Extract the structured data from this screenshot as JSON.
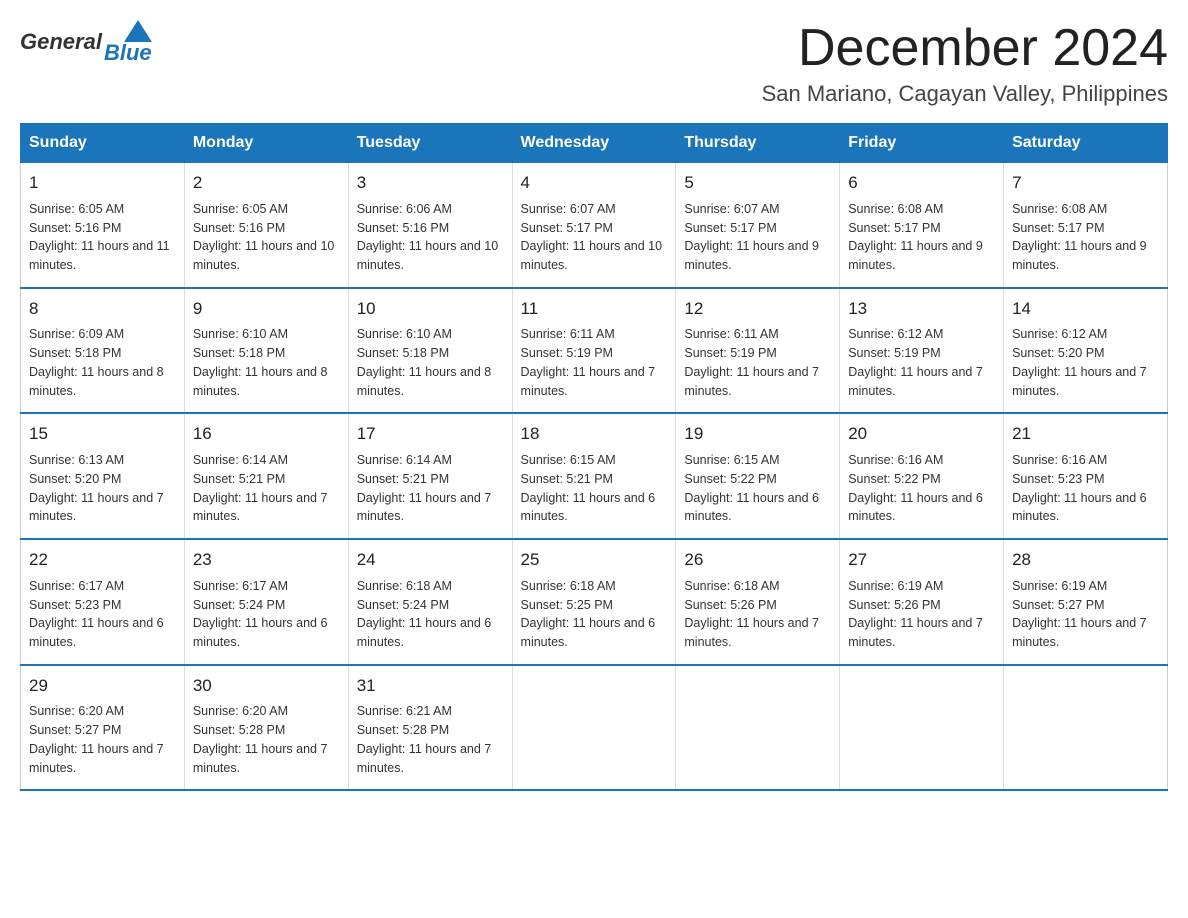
{
  "logo": {
    "general": "General",
    "blue": "Blue"
  },
  "header": {
    "month": "December 2024",
    "location": "San Mariano, Cagayan Valley, Philippines"
  },
  "days_of_week": [
    "Sunday",
    "Monday",
    "Tuesday",
    "Wednesday",
    "Thursday",
    "Friday",
    "Saturday"
  ],
  "weeks": [
    [
      {
        "day": "1",
        "sunrise": "6:05 AM",
        "sunset": "5:16 PM",
        "daylight": "11 hours and 11 minutes."
      },
      {
        "day": "2",
        "sunrise": "6:05 AM",
        "sunset": "5:16 PM",
        "daylight": "11 hours and 10 minutes."
      },
      {
        "day": "3",
        "sunrise": "6:06 AM",
        "sunset": "5:16 PM",
        "daylight": "11 hours and 10 minutes."
      },
      {
        "day": "4",
        "sunrise": "6:07 AM",
        "sunset": "5:17 PM",
        "daylight": "11 hours and 10 minutes."
      },
      {
        "day": "5",
        "sunrise": "6:07 AM",
        "sunset": "5:17 PM",
        "daylight": "11 hours and 9 minutes."
      },
      {
        "day": "6",
        "sunrise": "6:08 AM",
        "sunset": "5:17 PM",
        "daylight": "11 hours and 9 minutes."
      },
      {
        "day": "7",
        "sunrise": "6:08 AM",
        "sunset": "5:17 PM",
        "daylight": "11 hours and 9 minutes."
      }
    ],
    [
      {
        "day": "8",
        "sunrise": "6:09 AM",
        "sunset": "5:18 PM",
        "daylight": "11 hours and 8 minutes."
      },
      {
        "day": "9",
        "sunrise": "6:10 AM",
        "sunset": "5:18 PM",
        "daylight": "11 hours and 8 minutes."
      },
      {
        "day": "10",
        "sunrise": "6:10 AM",
        "sunset": "5:18 PM",
        "daylight": "11 hours and 8 minutes."
      },
      {
        "day": "11",
        "sunrise": "6:11 AM",
        "sunset": "5:19 PM",
        "daylight": "11 hours and 7 minutes."
      },
      {
        "day": "12",
        "sunrise": "6:11 AM",
        "sunset": "5:19 PM",
        "daylight": "11 hours and 7 minutes."
      },
      {
        "day": "13",
        "sunrise": "6:12 AM",
        "sunset": "5:19 PM",
        "daylight": "11 hours and 7 minutes."
      },
      {
        "day": "14",
        "sunrise": "6:12 AM",
        "sunset": "5:20 PM",
        "daylight": "11 hours and 7 minutes."
      }
    ],
    [
      {
        "day": "15",
        "sunrise": "6:13 AM",
        "sunset": "5:20 PM",
        "daylight": "11 hours and 7 minutes."
      },
      {
        "day": "16",
        "sunrise": "6:14 AM",
        "sunset": "5:21 PM",
        "daylight": "11 hours and 7 minutes."
      },
      {
        "day": "17",
        "sunrise": "6:14 AM",
        "sunset": "5:21 PM",
        "daylight": "11 hours and 7 minutes."
      },
      {
        "day": "18",
        "sunrise": "6:15 AM",
        "sunset": "5:21 PM",
        "daylight": "11 hours and 6 minutes."
      },
      {
        "day": "19",
        "sunrise": "6:15 AM",
        "sunset": "5:22 PM",
        "daylight": "11 hours and 6 minutes."
      },
      {
        "day": "20",
        "sunrise": "6:16 AM",
        "sunset": "5:22 PM",
        "daylight": "11 hours and 6 minutes."
      },
      {
        "day": "21",
        "sunrise": "6:16 AM",
        "sunset": "5:23 PM",
        "daylight": "11 hours and 6 minutes."
      }
    ],
    [
      {
        "day": "22",
        "sunrise": "6:17 AM",
        "sunset": "5:23 PM",
        "daylight": "11 hours and 6 minutes."
      },
      {
        "day": "23",
        "sunrise": "6:17 AM",
        "sunset": "5:24 PM",
        "daylight": "11 hours and 6 minutes."
      },
      {
        "day": "24",
        "sunrise": "6:18 AM",
        "sunset": "5:24 PM",
        "daylight": "11 hours and 6 minutes."
      },
      {
        "day": "25",
        "sunrise": "6:18 AM",
        "sunset": "5:25 PM",
        "daylight": "11 hours and 6 minutes."
      },
      {
        "day": "26",
        "sunrise": "6:18 AM",
        "sunset": "5:26 PM",
        "daylight": "11 hours and 7 minutes."
      },
      {
        "day": "27",
        "sunrise": "6:19 AM",
        "sunset": "5:26 PM",
        "daylight": "11 hours and 7 minutes."
      },
      {
        "day": "28",
        "sunrise": "6:19 AM",
        "sunset": "5:27 PM",
        "daylight": "11 hours and 7 minutes."
      }
    ],
    [
      {
        "day": "29",
        "sunrise": "6:20 AM",
        "sunset": "5:27 PM",
        "daylight": "11 hours and 7 minutes."
      },
      {
        "day": "30",
        "sunrise": "6:20 AM",
        "sunset": "5:28 PM",
        "daylight": "11 hours and 7 minutes."
      },
      {
        "day": "31",
        "sunrise": "6:21 AM",
        "sunset": "5:28 PM",
        "daylight": "11 hours and 7 minutes."
      },
      null,
      null,
      null,
      null
    ]
  ]
}
